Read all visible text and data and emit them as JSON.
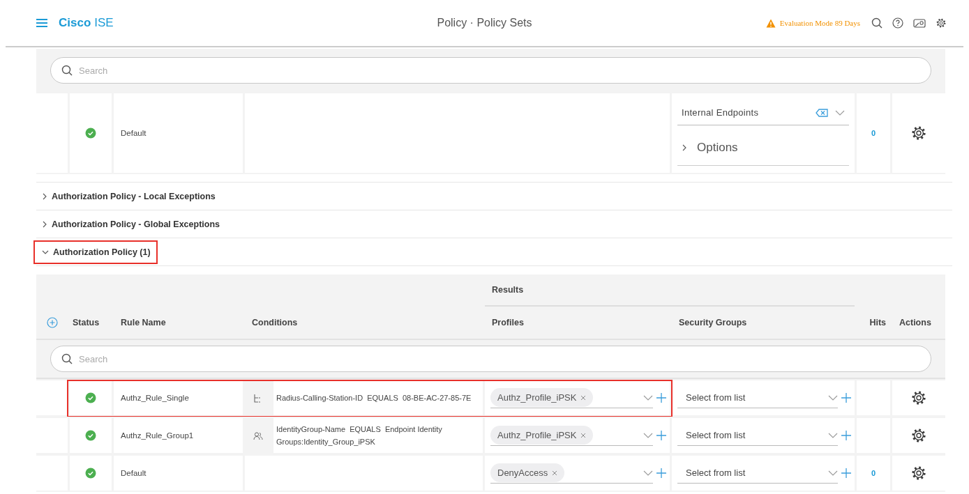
{
  "header": {
    "brand_bold": "Cisco",
    "brand_light": "ISE",
    "title": "Policy · Policy Sets",
    "warning": "Evaluation Mode 89 Days"
  },
  "authentication_default": {
    "search_placeholder": "Search",
    "status_enabled": true,
    "name": "Default",
    "identity_source": "Internal Endpoints",
    "options_label": "Options",
    "options_expanded": false,
    "hits": "0"
  },
  "sections": [
    {
      "label": "Authorization Policy - Local Exceptions",
      "expanded": false,
      "highlighted": false
    },
    {
      "label": "Authorization Policy - Global Exceptions",
      "expanded": false,
      "highlighted": false
    },
    {
      "label": "Authorization Policy (1)",
      "expanded": true,
      "highlighted": true
    }
  ],
  "authorization_table": {
    "results_label": "Results",
    "columns": [
      "Status",
      "Rule Name",
      "Conditions",
      "Profiles",
      "Security Groups",
      "Hits",
      "Actions"
    ],
    "search_placeholder": "Search",
    "rows": [
      {
        "kind": "attribute",
        "status_enabled": true,
        "name": "Authz_Rule_Single",
        "condition": "Radius-Calling-Station-ID  EQUALS  08-BE-AC-27-85-7E",
        "profile": "Authz_Profile_iPSK",
        "security_group": "Select from list",
        "hits": "",
        "highlighted": true
      },
      {
        "kind": "group",
        "status_enabled": true,
        "name": "Authz_Rule_Group1",
        "condition": "IdentityGroup-Name  EQUALS  Endpoint Identity Groups:Identity_Group_iPSK",
        "profile": "Authz_Profile_iPSK",
        "security_group": "Select from list",
        "hits": "",
        "highlighted": false
      },
      {
        "kind": "default",
        "status_enabled": true,
        "name": "Default",
        "condition": "",
        "profile": "DenyAccess",
        "security_group": "Select from list",
        "hits": "0",
        "highlighted": false
      }
    ]
  }
}
